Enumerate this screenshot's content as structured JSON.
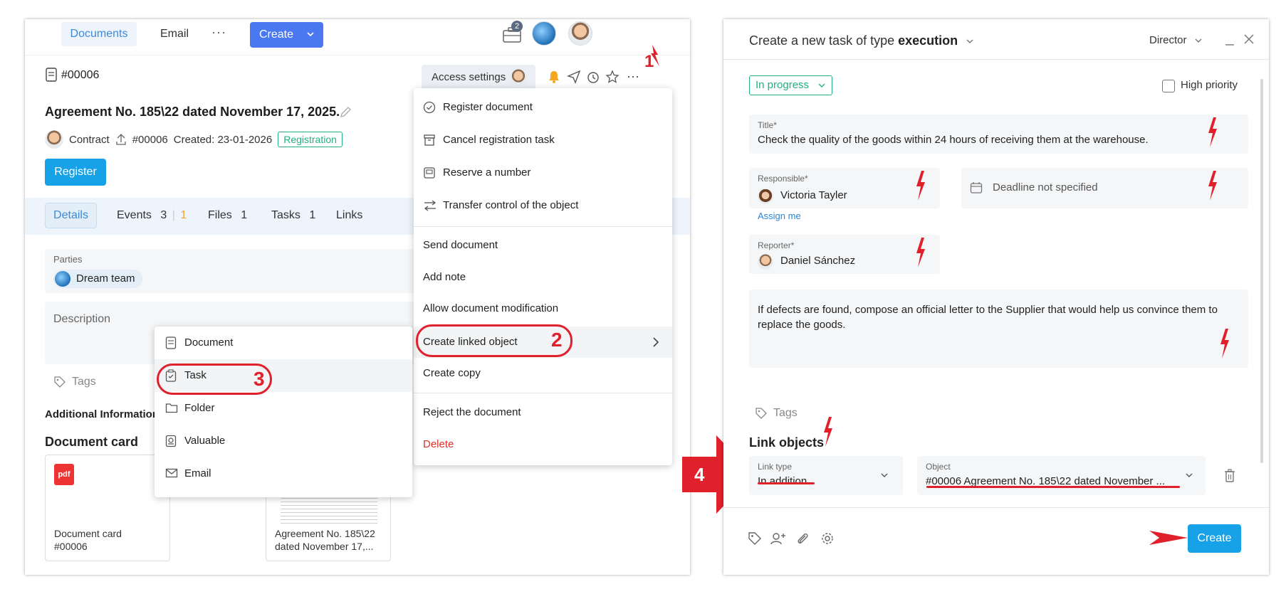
{
  "left": {
    "topbar": {
      "tab_documents": "Documents",
      "tab_email": "Email",
      "more": "···",
      "create_label": "Create",
      "notification_count": "2"
    },
    "doc_number": "#00006",
    "access_settings": "Access settings",
    "doc_title": "Agreement No. 185\\22 dated November 17, 2025.",
    "meta": {
      "type": "Contract",
      "number": "#00006",
      "created": "Created: 23-01-2026",
      "status": "Registration"
    },
    "register_button": "Register",
    "tabs": {
      "details": "Details",
      "events": "Events",
      "events_count_a": "3",
      "events_count_b": "1",
      "files": "Files",
      "files_count": "1",
      "tasks": "Tasks",
      "tasks_count": "1",
      "links": "Links"
    },
    "parties_label": "Parties",
    "parties_chip": "Dream team",
    "description_label": "Description",
    "tags_label": "Tags",
    "additional_info": "Additional Information",
    "doc_card_title": "Document card",
    "files": [
      {
        "name_line1": "Document card",
        "name_line2": "#00006",
        "badge": "pdf"
      },
      {
        "name_line1": "Agreement No. 185\\22",
        "name_line2": "dated November 17,..."
      }
    ],
    "menu": {
      "items": [
        "Register document",
        "Cancel registration task",
        "Reserve a number",
        "Transfer control of the object",
        "Send document",
        "Add note",
        "Allow document modification",
        "Create linked object",
        "Create copy",
        "Reject the document",
        "Delete"
      ]
    },
    "submenu": {
      "items": [
        "Document",
        "Task",
        "Folder",
        "Valuable",
        "Email"
      ]
    }
  },
  "right": {
    "title_prefix": "Create a new task of type",
    "title_type": "execution",
    "role": "Director",
    "status": "In progress",
    "high_priority": "High priority",
    "title_label": "Title*",
    "title_value": "Check the quality of the goods within 24 hours of receiving them at the warehouse.",
    "responsible_label": "Responsible*",
    "responsible_value": "Victoria Tayler",
    "assign_me": "Assign me",
    "deadline": "Deadline not specified",
    "reporter_label": "Reporter*",
    "reporter_value": "Daniel Sánchez",
    "description": "If defects are found, compose an official letter to the Supplier that would help us convince them to replace the goods.",
    "tags_label": "Tags",
    "link_objects_title": "Link objects",
    "link_type_label": "Link type",
    "link_type_value": "In addition",
    "object_label": "Object",
    "object_value": "#00006 Agreement No. 185\\22 dated November ...",
    "create_button": "Create"
  },
  "annotations": {
    "step1": "1",
    "step2": "2",
    "step3": "3",
    "step4": "4",
    "color": "#e0202b"
  }
}
